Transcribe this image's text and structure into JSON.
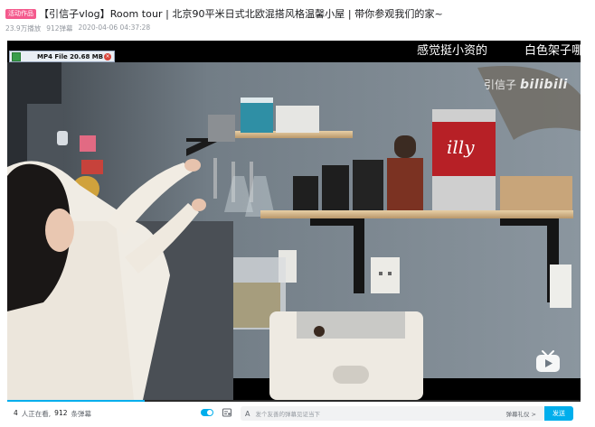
{
  "header": {
    "badge": "活动作品",
    "title": "【引信子vlog】Room tour | 北京90平米日式北欧混搭风格温馨小屋 | 带你参观我们的家~",
    "views": "23.9万播放",
    "danmaku_count": "912弹幕",
    "date": "2020-04-06 04:37:28"
  },
  "overlay": {
    "label": "MP4 File 20.68 MB",
    "close_glyph": "×"
  },
  "player": {
    "danmaku": [
      "感觉挺小资的",
      "白色架子哪"
    ],
    "watermark_text": "引信子",
    "watermark_logo": "bilibili",
    "progress": 0.24
  },
  "footer": {
    "watching_count": "4",
    "watching_label": "人正在看,",
    "danmaku_count": "912",
    "danmaku_label": "条弹幕",
    "input_icon": "A",
    "input_placeholder": "发个友善的弹幕见证当下",
    "etiquette_label": "弹幕礼仪 >",
    "send_label": "发送"
  },
  "colors": {
    "accent": "#00aeec",
    "badge": "#f45a8d"
  }
}
